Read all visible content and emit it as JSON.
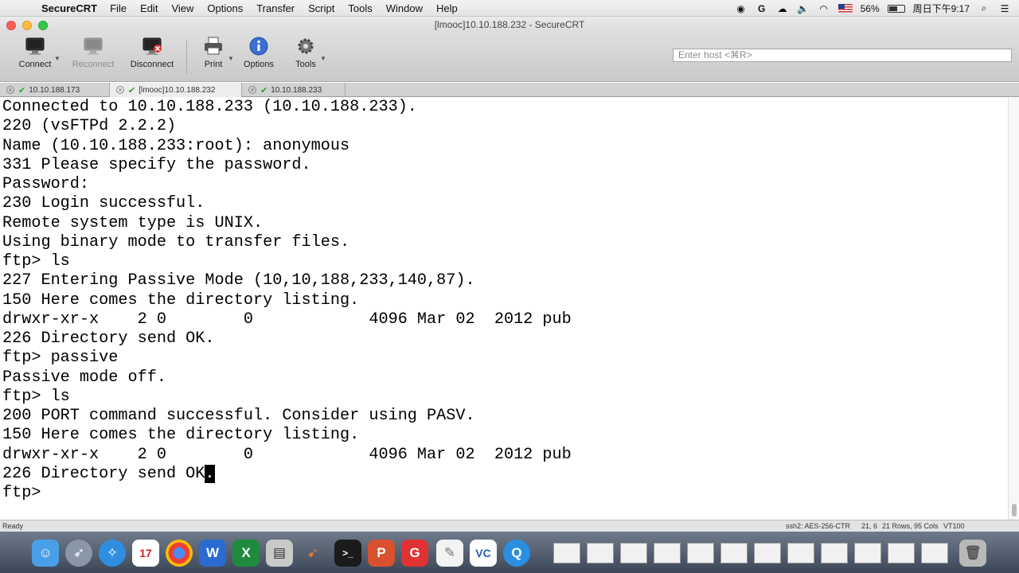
{
  "menubar": {
    "app_name": "SecureCRT",
    "menus": [
      "File",
      "Edit",
      "View",
      "Options",
      "Transfer",
      "Script",
      "Tools",
      "Window",
      "Help"
    ],
    "battery": "56%",
    "clock": "周日下午9:17"
  },
  "window": {
    "title": "[lmooc]10.10.188.232 - SecureCRT"
  },
  "toolbar": {
    "connect": "Connect",
    "reconnect": "Reconnect",
    "disconnect": "Disconnect",
    "print": "Print",
    "options": "Options",
    "tools": "Tools",
    "host_placeholder": "Enter host <⌘R>"
  },
  "tabs": [
    {
      "label": "10.10.188.173",
      "active": false
    },
    {
      "label": "[lmooc]10.10.188.232",
      "active": true
    },
    {
      "label": "10.10.188.233",
      "active": false
    }
  ],
  "terminal": {
    "lines": [
      "Connected to 10.10.188.233 (10.10.188.233).",
      "220 (vsFTPd 2.2.2)",
      "Name (10.10.188.233:root): anonymous",
      "331 Please specify the password.",
      "Password:",
      "230 Login successful.",
      "Remote system type is UNIX.",
      "Using binary mode to transfer files.",
      "ftp> ls",
      "227 Entering Passive Mode (10,10,188,233,140,87).",
      "150 Here comes the directory listing.",
      "drwxr-xr-x    2 0        0            4096 Mar 02  2012 pub",
      "226 Directory send OK.",
      "ftp> passive",
      "Passive mode off.",
      "ftp> ls",
      "200 PORT command successful. Consider using PASV.",
      "150 Here comes the directory listing.",
      "drwxr-xr-x    2 0        0            4096 Mar 02  2012 pub",
      "226 Directory send OK",
      "ftp>"
    ],
    "cursor_char": "."
  },
  "statusbar": {
    "ready": "Ready",
    "cipher": "ssh2: AES-256-CTR",
    "position": "21, 6",
    "size": "21 Rows, 95 Cols",
    "emulation": "VT100"
  },
  "dock": {
    "calendar_day": "17"
  }
}
